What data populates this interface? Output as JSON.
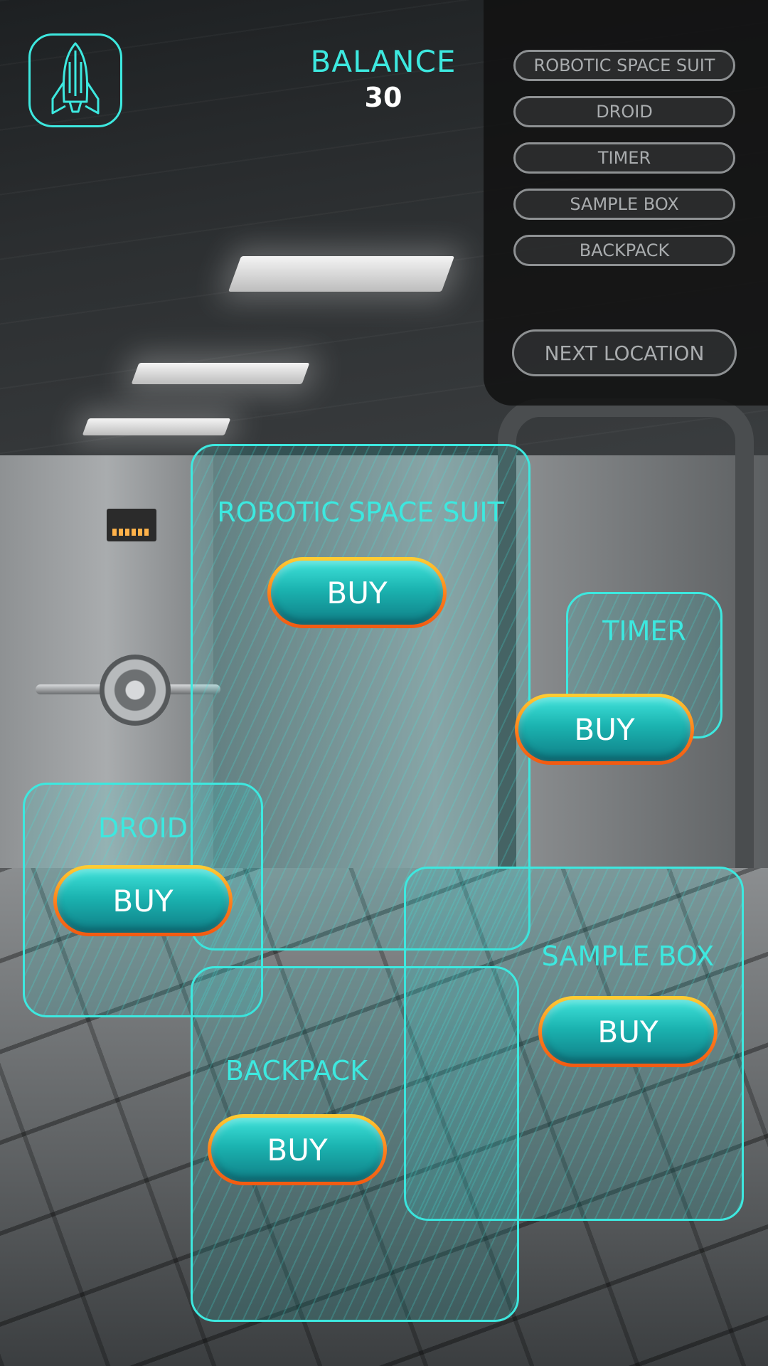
{
  "balance": {
    "label": "BALANCE",
    "value": "30"
  },
  "menu": {
    "items": [
      {
        "label": "ROBOTIC SPACE SUIT"
      },
      {
        "label": "DROID"
      },
      {
        "label": "TIMER"
      },
      {
        "label": "SAMPLE BOX"
      },
      {
        "label": "BACKPACK"
      }
    ],
    "next_label": "NEXT LOCATION"
  },
  "shop": {
    "buy_label": "BUY",
    "cards": [
      {
        "title": "ROBOTIC SPACE SUIT"
      },
      {
        "title": "TIMER"
      },
      {
        "title": "DROID"
      },
      {
        "title": "SAMPLE BOX"
      },
      {
        "title": "BACKPACK"
      }
    ]
  },
  "colors": {
    "accent": "#3de8df",
    "button_border": "#ff7a1a",
    "menu_border": "#8e9193"
  },
  "icons": {
    "logo": "rocket-icon"
  }
}
